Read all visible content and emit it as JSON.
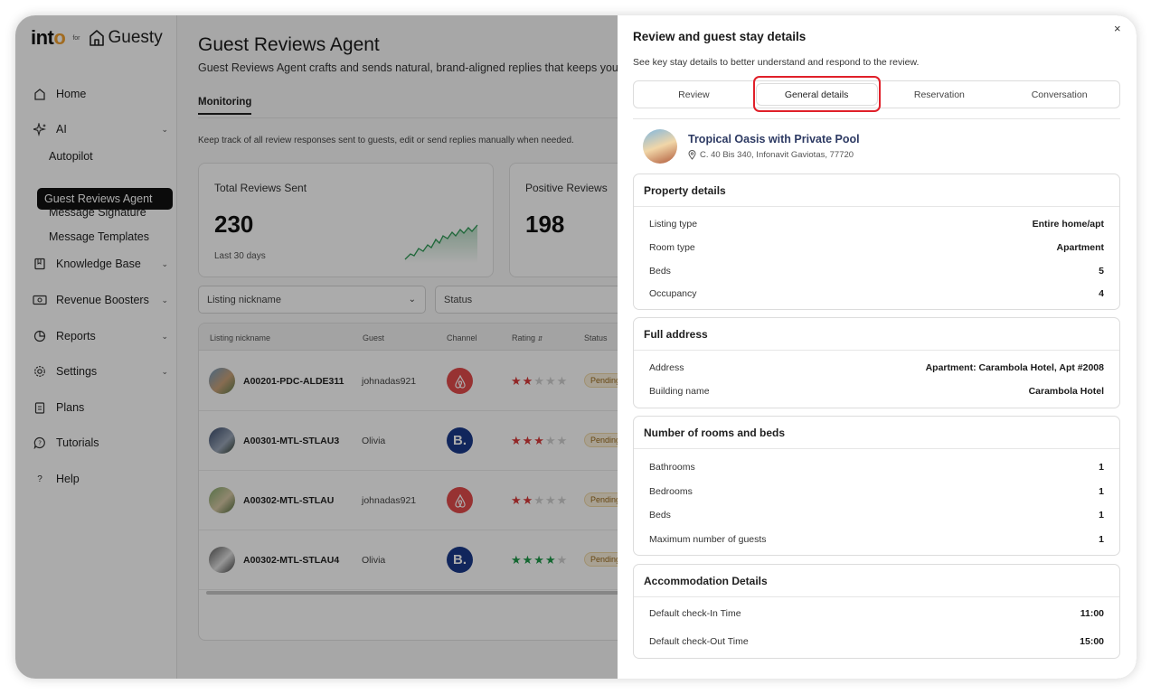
{
  "logo": {
    "into": "int",
    "into_o": "o",
    "for": "for",
    "guesty": "Guesty"
  },
  "sidebar": {
    "items": [
      {
        "label": "Home",
        "icon": "home-icon"
      },
      {
        "label": "AI",
        "icon": "sparkle-icon"
      },
      {
        "label": "Knowledge Base",
        "icon": "book-icon"
      },
      {
        "label": "Revenue Boosters",
        "icon": "money-icon"
      },
      {
        "label": "Reports",
        "icon": "pie-chart-icon"
      },
      {
        "label": "Settings",
        "icon": "gear-icon"
      },
      {
        "label": "Plans",
        "icon": "clipboard-icon"
      },
      {
        "label": "Tutorials",
        "icon": "chat-help-icon"
      },
      {
        "label": "Help",
        "icon": "question-icon"
      }
    ],
    "ai_sub": [
      "Autopilot",
      "Guest Reviews Agent",
      "Message Signature",
      "Message Templates"
    ]
  },
  "main": {
    "title": "Guest Reviews Agent",
    "subtitle": "Guest Reviews Agent crafts and sends natural, brand-aligned replies that keeps you conn",
    "tab": "Monitoring",
    "description": "Keep track of all review responses sent to guests, edit or send replies manually when needed.",
    "cards": [
      {
        "label": "Total Reviews Sent",
        "value": "230",
        "sub": "Last 30 days"
      },
      {
        "label": "Positive Reviews",
        "value": "198"
      }
    ],
    "filters": {
      "listing": "Listing nickname",
      "status": "Status"
    },
    "table": {
      "headers": [
        "Listing nickname",
        "Guest",
        "Channel",
        "Rating",
        "Status"
      ],
      "rows": [
        {
          "listing": "A00201-PDC-ALDE311",
          "guest": "johnadas921",
          "channel": "airbnb",
          "rating": 2,
          "status": "Pending"
        },
        {
          "listing": "A00301-MTL-STLAU3",
          "guest": "Olivia",
          "channel": "booking",
          "rating": 3,
          "status": "Pending"
        },
        {
          "listing": "A00302-MTL-STLAU",
          "guest": "johnadas921",
          "channel": "airbnb",
          "rating": 2,
          "status": "Pending"
        },
        {
          "listing": "A00302-MTL-STLAU4",
          "guest": "Olivia",
          "channel": "booking",
          "rating": 4,
          "status": "Pending"
        }
      ]
    }
  },
  "drawer": {
    "title": "Review and guest stay details",
    "subtitle": "See key stay details to better understand and respond to the review.",
    "close": "×",
    "tabs": [
      "Review",
      "General details",
      "Reservation",
      "Conversation"
    ],
    "active_tab": "General details",
    "property": {
      "name": "Tropical Oasis with Private Pool",
      "address": "C. 40 Bis 340, Infonavit Gaviotas, 77720"
    },
    "sections": {
      "property_details": {
        "title": "Property details",
        "rows": [
          {
            "k": "Listing type",
            "v": "Entire home/apt"
          },
          {
            "k": "Room type",
            "v": "Apartment"
          },
          {
            "k": "Beds",
            "v": "5"
          },
          {
            "k": "Occupancy",
            "v": "4"
          }
        ]
      },
      "full_address": {
        "title": "Full address",
        "rows": [
          {
            "k": "Address",
            "v": "Apartment: Carambola Hotel, Apt #2008"
          },
          {
            "k": "Building name",
            "v": "Carambola Hotel"
          }
        ]
      },
      "rooms_beds": {
        "title": "Number of rooms and beds",
        "rows": [
          {
            "k": "Bathrooms",
            "v": "1"
          },
          {
            "k": "Bedrooms",
            "v": "1"
          },
          {
            "k": "Beds",
            "v": "1"
          },
          {
            "k": "Maximum number of guests",
            "v": "1"
          }
        ]
      },
      "accommodation": {
        "title": "Accommodation Details",
        "rows": [
          {
            "k": "Default check-In Time",
            "v": "11:00"
          },
          {
            "k": "Default check-Out Time",
            "v": "15:00"
          }
        ]
      }
    }
  },
  "colors": {
    "airbnb": "#e14b4b",
    "booking": "#1a3a8a",
    "star_red": "#d83a3a",
    "star_green": "#1f9a4a",
    "highlight": "#e0202a"
  }
}
